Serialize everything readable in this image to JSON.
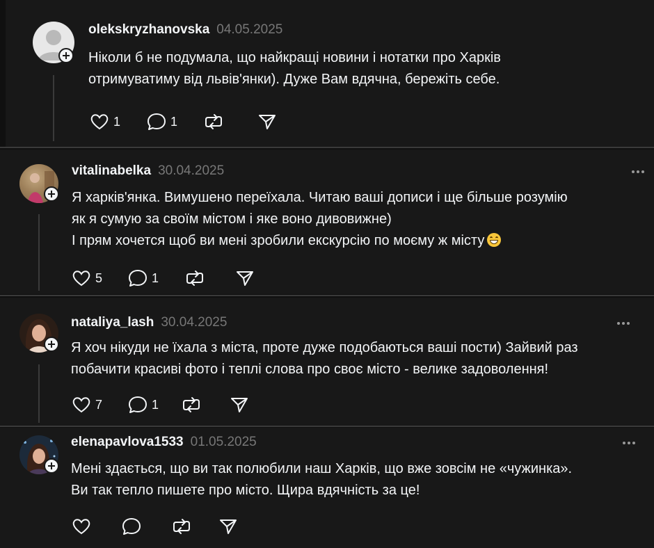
{
  "posts": [
    {
      "username": "olekskryzhanovska",
      "date": "04.05.2025",
      "lines": [
        "Ніколи б не подумала, що найкращі новини і нотатки про Харків",
        "отримуватиму від львів'янки). Дуже Вам вдячна, бережіть себе."
      ],
      "likes": "1",
      "replies": "1"
    },
    {
      "username": "vitalinabelka",
      "date": "30.04.2025",
      "lines": [
        "Я харків'янка. Вимушено переїхала. Читаю ваші дописи і ще більше розумію",
        "як я сумую за своїм містом і яке воно дивовижне)",
        "І прям хочется щоб ви мені зробили екскурсію по моєму ж місту"
      ],
      "likes": "5",
      "replies": "1"
    },
    {
      "username": "nataliya_lash",
      "date": "30.04.2025",
      "lines": [
        "Я хоч нікуди не їхала з міста, проте дуже подобаються ваші пости) Зайвий раз",
        "побачити красиві фото і теплі слова про своє місто - велике задоволення!"
      ],
      "likes": "7",
      "replies": "1"
    },
    {
      "username": "elenapavlova1533",
      "date": "01.05.2025",
      "lines": [
        "Мені здається, що ви так полюбили наш Харків, що вже зовсім не «чужинка».",
        "Ви так тепло пишете про місто. Щира вдячність за це!"
      ],
      "likes": "",
      "replies": ""
    }
  ],
  "icons": {
    "like": "heart-icon",
    "reply": "comment-icon",
    "repost": "repost-icon",
    "share": "send-icon",
    "follow": "plus-icon",
    "more": "more-options-icon",
    "emoji": "grinning-face-emoji"
  },
  "colors": {
    "background": "#181818",
    "text": "#f3f5f7",
    "secondary": "#777777"
  }
}
